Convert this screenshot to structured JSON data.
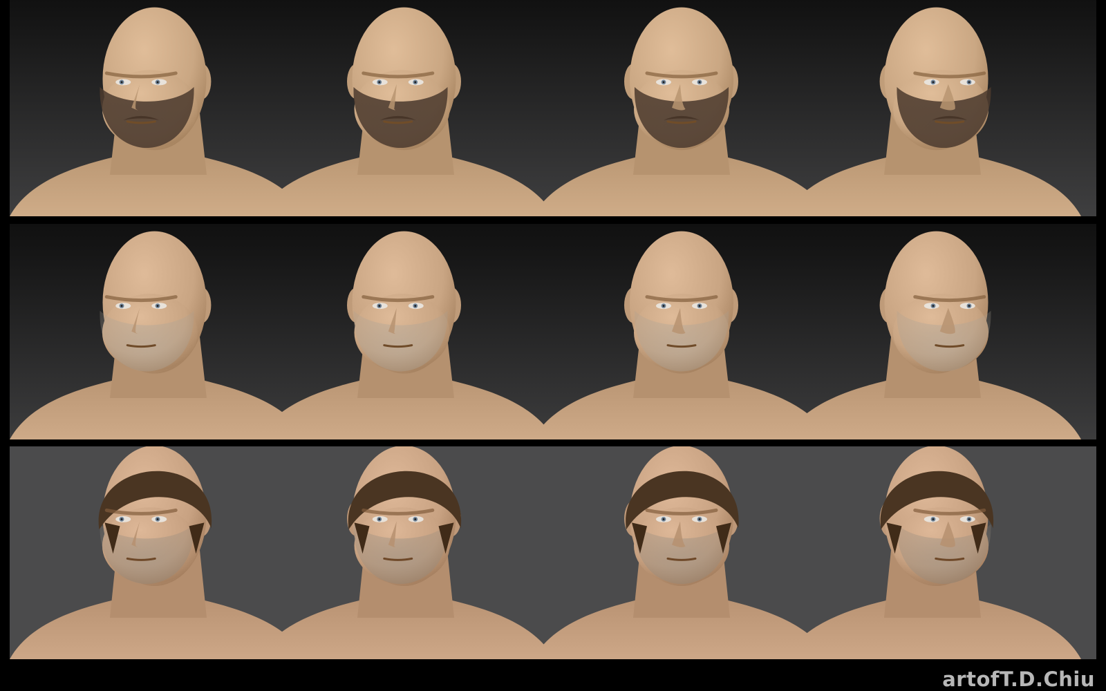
{
  "watermark": "artofT.D.Chiu",
  "rows": [
    {
      "variant": "full beard",
      "background": [
        "#111111",
        "#3f3f40"
      ],
      "skin": "#caa783",
      "beard": "#4c3a2d",
      "hair": null
    },
    {
      "variant": "stubble",
      "background": [
        "#101010",
        "#3c3c3d"
      ],
      "skin": "#c9a583",
      "beard": "#a8a094",
      "hair": null
    },
    {
      "variant": "hair and stubble",
      "background": [
        "#4b4b4c",
        "#4b4b4c"
      ],
      "skin": "#c8a282",
      "beard": "#8f877c",
      "hair": "#4a3522"
    }
  ],
  "views": [
    "three-quarter-left",
    "slight-left",
    "front",
    "three-quarter-right"
  ]
}
